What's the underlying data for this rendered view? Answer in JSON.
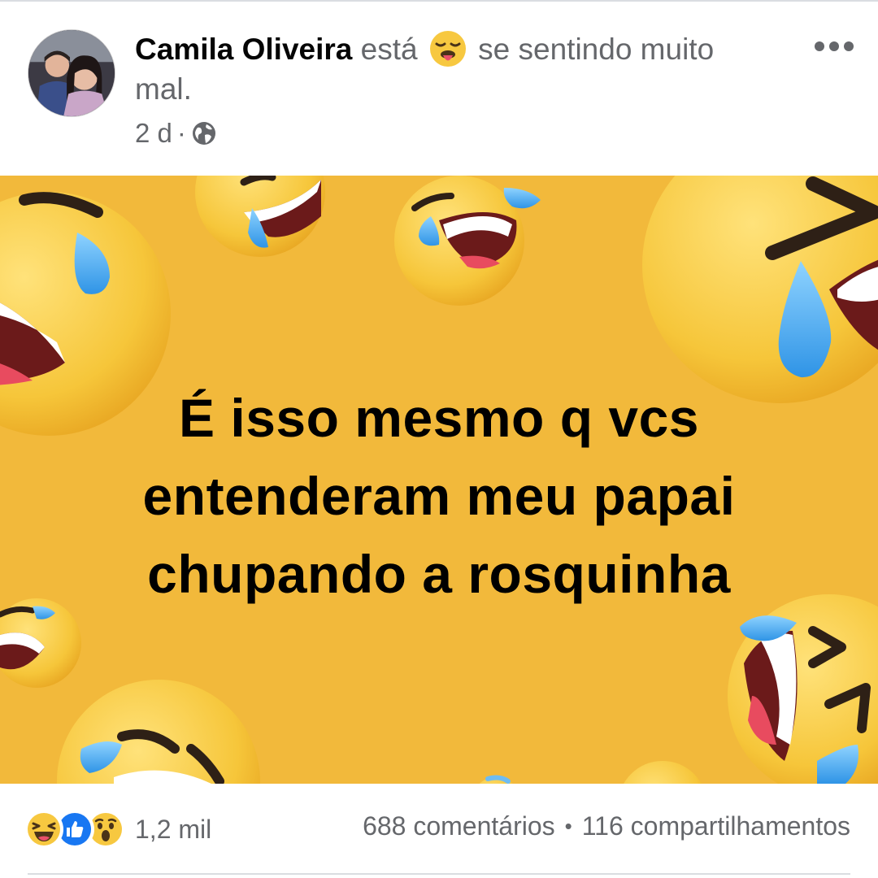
{
  "post": {
    "author": "Camila Oliveira",
    "feeling_verb": "está",
    "feeling_icon": "feeling-sick-emoji-icon",
    "feeling_text": "se sentindo muito mal.",
    "time": "2 d",
    "time_separator": "·",
    "privacy_icon": "globe-icon"
  },
  "image_card": {
    "background_color": "#f2b93b",
    "text": "É isso mesmo q vcs entenderam meu papai chupando a rosquinha"
  },
  "footer": {
    "reaction_icons": [
      "haha-reaction-icon",
      "like-reaction-icon",
      "wow-reaction-icon"
    ],
    "reaction_count": "1,2 mil",
    "comments": "688 comentários",
    "separator": "•",
    "shares": "116 compartilhamentos"
  },
  "colors": {
    "secondary_text": "#65676b",
    "like_blue": "#1877f2",
    "emoji_yellow": "#f7c840"
  }
}
